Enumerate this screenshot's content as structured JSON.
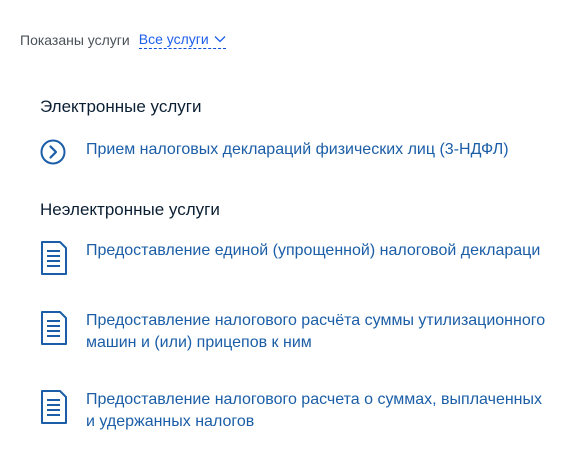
{
  "filter": {
    "label": "Показаны услуги",
    "selected": "Все услуги"
  },
  "sections": [
    {
      "title": "Электронные услуги",
      "items": [
        {
          "icon": "arrow-circle-icon",
          "lines": [
            "Прием налоговых деклараций физических лиц (3-НДФЛ)"
          ]
        }
      ]
    },
    {
      "title": "Неэлектронные услуги",
      "items": [
        {
          "icon": "document-icon",
          "lines": [
            "Предоставление единой (упрощенной) налоговой деклараци"
          ]
        },
        {
          "icon": "document-icon",
          "lines": [
            "Предоставление налогового расчёта суммы утилизационного",
            "машин и (или) прицепов к ним"
          ]
        },
        {
          "icon": "document-icon",
          "lines": [
            "Предоставление налогового расчета о суммах, выплаченных",
            "и удержанных налогов"
          ]
        }
      ]
    }
  ],
  "colors": {
    "link": "#1b5ea7",
    "icon": "#1b5ea7",
    "heading": "#0b1f33",
    "label": "#4a5259"
  }
}
